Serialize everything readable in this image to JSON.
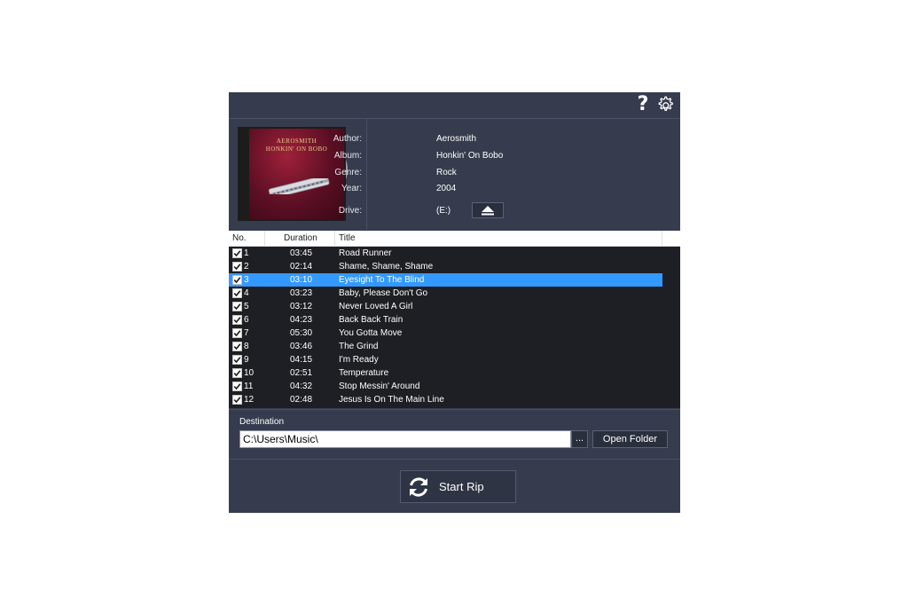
{
  "toolbar": {
    "help_icon": "question-mark-icon",
    "settings_icon": "gear-icon"
  },
  "album": {
    "cover_title_line1": "AEROSMITH",
    "cover_title_line2": "HONKIN' ON BOBO",
    "fields": [
      {
        "label": "Author:",
        "value": "Aerosmith"
      },
      {
        "label": "Album:",
        "value": "Honkin' On Bobo"
      },
      {
        "label": "Genre:",
        "value": "Rock"
      },
      {
        "label": "Year:",
        "value": "2004"
      },
      {
        "label": "Drive:",
        "value": "(E:)"
      }
    ],
    "eject_icon": "eject-icon"
  },
  "table": {
    "headers": {
      "no": "No.",
      "duration": "Duration",
      "title": "Title"
    },
    "selected_index": 2,
    "tracks": [
      {
        "no": "1",
        "duration": "03:45",
        "title": "Road Runner",
        "checked": true
      },
      {
        "no": "2",
        "duration": "02:14",
        "title": "Shame, Shame, Shame",
        "checked": true
      },
      {
        "no": "3",
        "duration": "03:10",
        "title": "Eyesight To The Blind",
        "checked": true
      },
      {
        "no": "4",
        "duration": "03:23",
        "title": "Baby, Please Don't Go",
        "checked": true
      },
      {
        "no": "5",
        "duration": "03:12",
        "title": "Never Loved A Girl",
        "checked": true
      },
      {
        "no": "6",
        "duration": "04:23",
        "title": "Back Back Train",
        "checked": true
      },
      {
        "no": "7",
        "duration": "05:30",
        "title": "You Gotta Move",
        "checked": true
      },
      {
        "no": "8",
        "duration": "03:46",
        "title": "The Grind",
        "checked": true
      },
      {
        "no": "9",
        "duration": "04:15",
        "title": "I'm Ready",
        "checked": true
      },
      {
        "no": "10",
        "duration": "02:51",
        "title": "Temperature",
        "checked": true
      },
      {
        "no": "11",
        "duration": "04:32",
        "title": "Stop Messin' Around",
        "checked": true
      },
      {
        "no": "12",
        "duration": "02:48",
        "title": "Jesus Is On The Main Line",
        "checked": true
      }
    ]
  },
  "destination": {
    "label": "Destination",
    "path": "C:\\Users\\Music\\",
    "browse_label": "...",
    "open_folder_label": "Open Folder"
  },
  "actions": {
    "start_rip_label": "Start Rip",
    "start_rip_icon": "refresh-icon"
  },
  "colors": {
    "panel": "#363c4e",
    "list_bg": "#1e1f24",
    "selection": "#3399ff"
  }
}
